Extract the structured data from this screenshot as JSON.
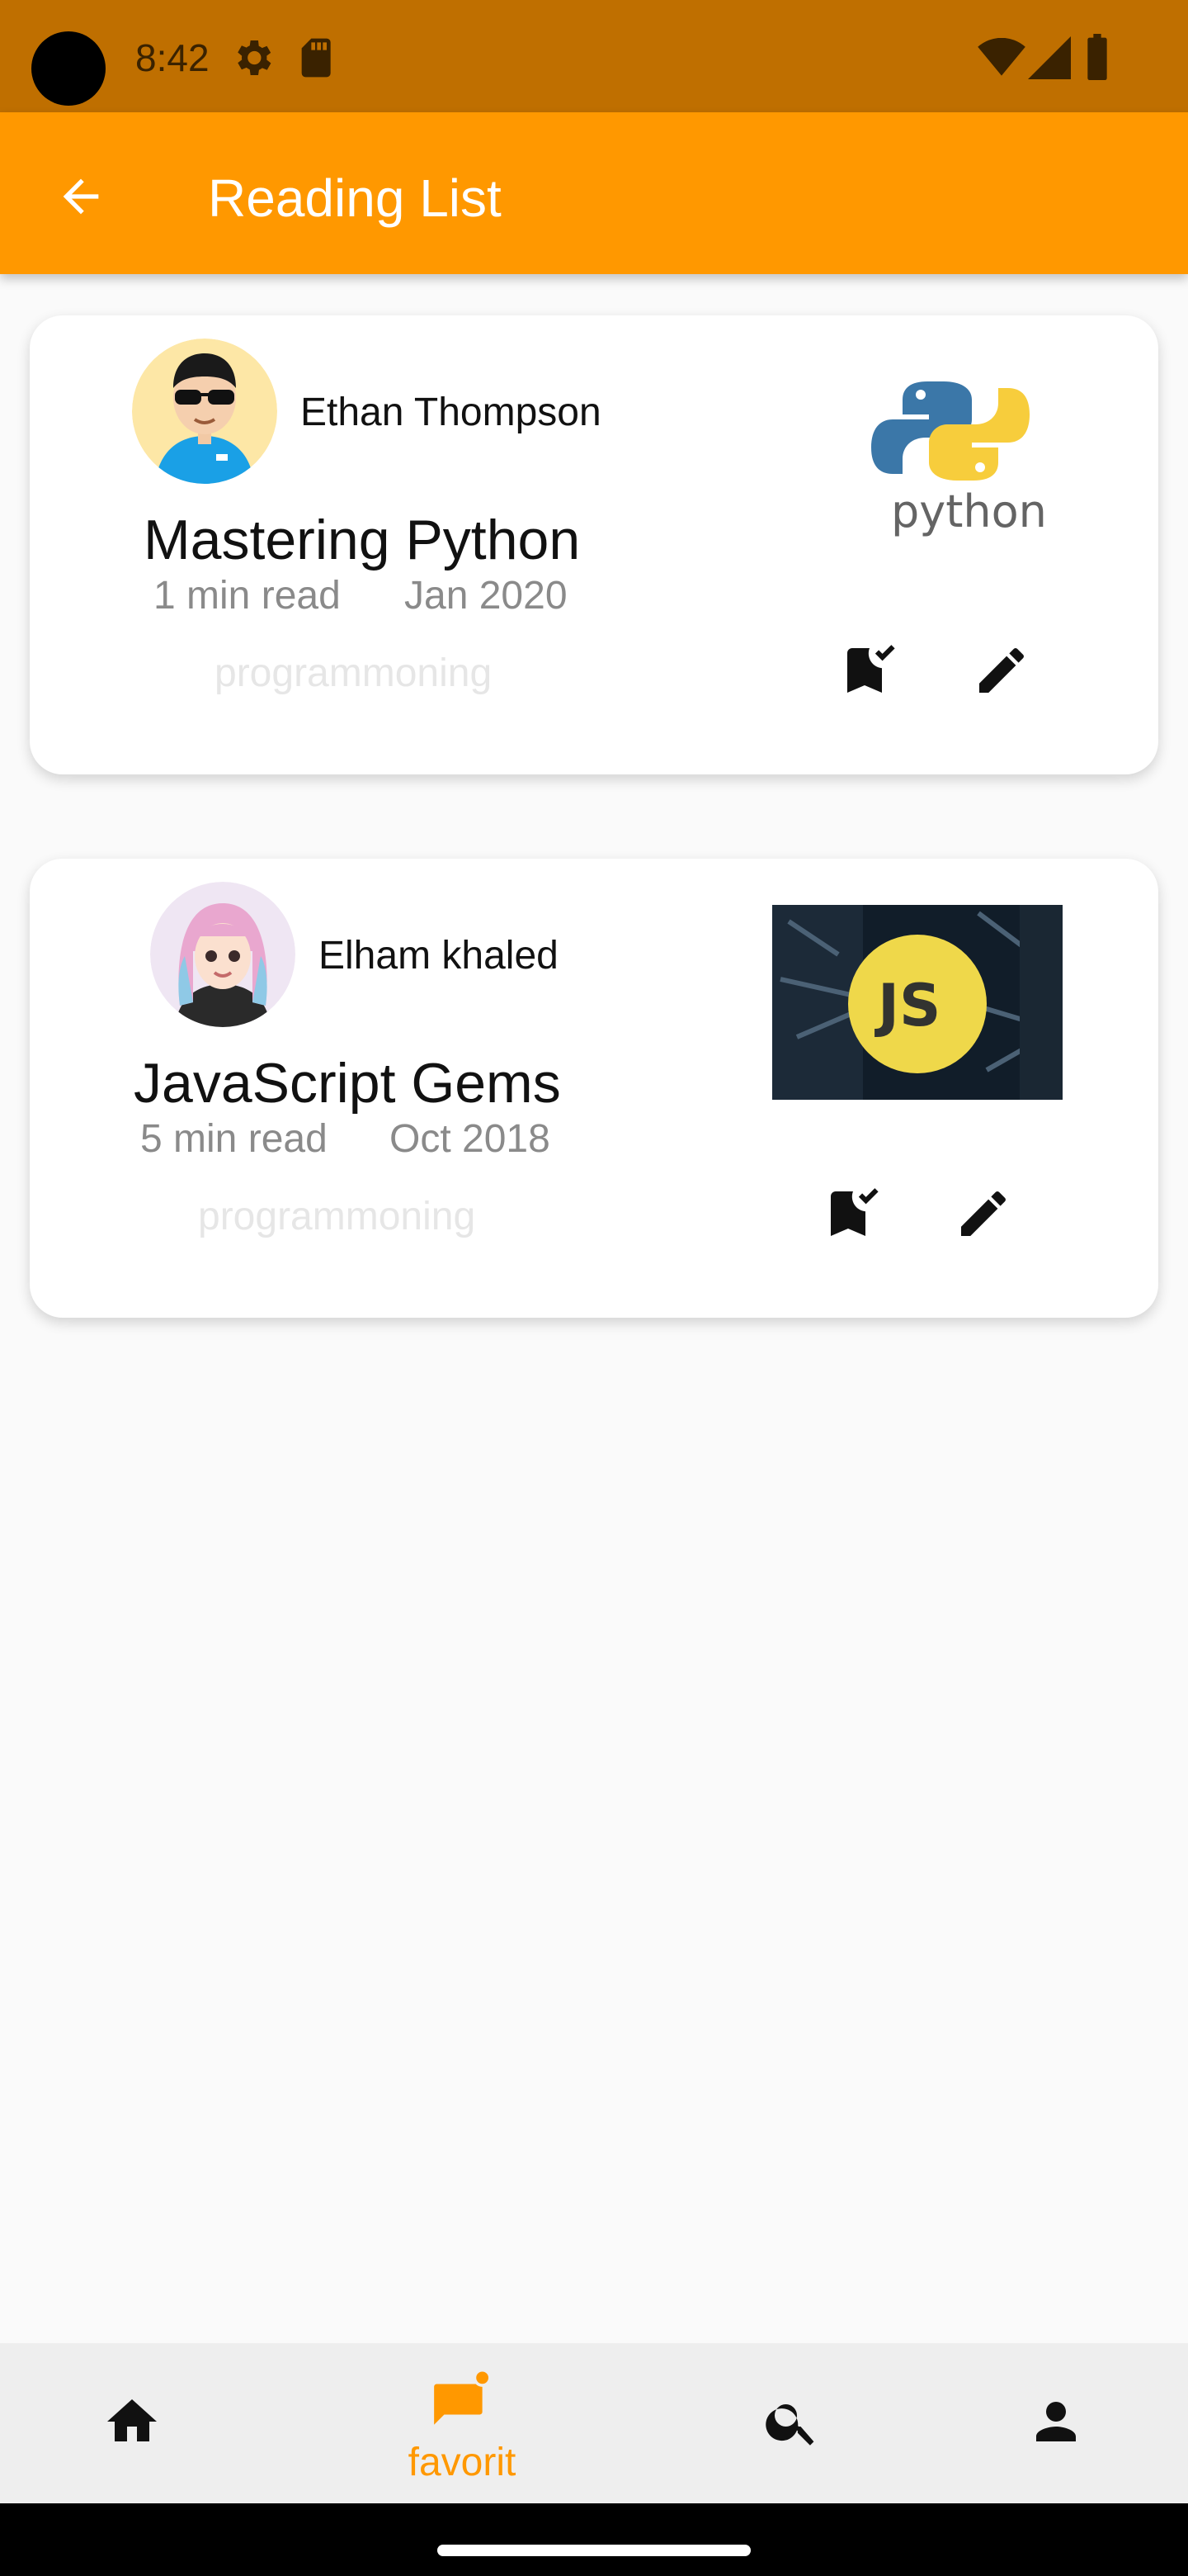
{
  "status_bar": {
    "time": "8:42",
    "icons": [
      "settings-icon",
      "sd-card-icon",
      "wifi-icon",
      "signal-icon",
      "battery-icon"
    ]
  },
  "app_bar": {
    "title": "Reading List",
    "back_icon": "arrow-back-icon",
    "background": "#ff9800"
  },
  "books": [
    {
      "author": "Ethan Thompson",
      "title": "Mastering Python",
      "read_time": "1 min read",
      "date": "Jan 2020",
      "category": "programmoning",
      "cover": "python-logo",
      "cover_text": "python",
      "actions": [
        "bookmark-added-icon",
        "edit-icon"
      ]
    },
    {
      "author": "Elham khaled",
      "title": "JavaScript Gems",
      "read_time": "5 min read",
      "date": "Oct 2018",
      "category": "programmoning",
      "cover": "javascript-logo",
      "cover_text": "JS",
      "actions": [
        "bookmark-added-icon",
        "edit-icon"
      ]
    }
  ],
  "bottom_nav": {
    "items": [
      {
        "icon": "home-icon",
        "label": ""
      },
      {
        "icon": "favorite-chat-icon",
        "label": "favorit",
        "active": true
      },
      {
        "icon": "search-icon",
        "label": ""
      },
      {
        "icon": "person-icon",
        "label": ""
      }
    ],
    "active_color": "#ff9800"
  }
}
